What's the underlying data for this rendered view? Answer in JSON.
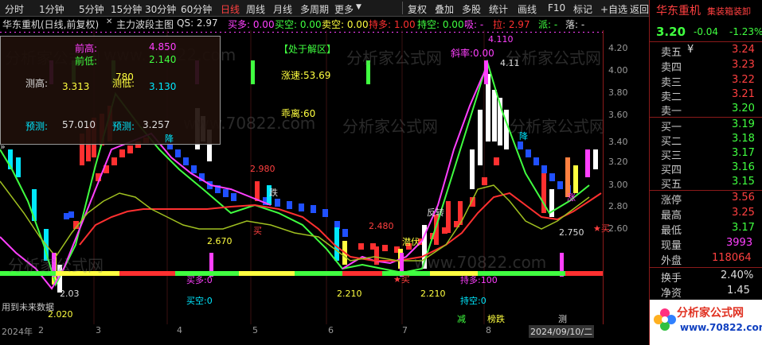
{
  "toolbar": {
    "periods": [
      "分时",
      "1分钟",
      "5分钟",
      "15分钟",
      "30分钟",
      "60分钟",
      "日线",
      "周线",
      "月线",
      "多周期",
      "更多"
    ],
    "active_period": "日线",
    "actions": [
      "复权",
      "叠加",
      "多股",
      "统计",
      "画线",
      "F10",
      "标记",
      "+自选",
      "返回"
    ]
  },
  "infobar": {
    "title": "华东重机(日线,前复权)",
    "indicator": "主力波段主图",
    "qs": "QS: 2.97",
    "buy_many": "买多: 0.00",
    "buy_empty": "买空: 0.00",
    "sell_empty": "卖空: 0.00",
    "hold_many": "持多: 1.00",
    "hold_empty": "持空: 0.00",
    "absorb": "吸: -",
    "pull": "拉: 2.97",
    "dispatch": "派: -",
    "drop": "落: -"
  },
  "infobox": {
    "prev_high_label": "前高:",
    "prev_high": "4.850",
    "prev_low_label": "前低:",
    "prev_low": "2.140",
    "measure_high_label": "测高:",
    "measure_high": "3.313",
    "measure_low_label": "测低:",
    "measure_low": "3.130",
    "forecast_label": "预测:",
    "forecast": "57.010",
    "forecast2_label": "预测:",
    "forecast2": "3.257"
  },
  "annotations": {
    "zone": "【处于解区】",
    "rise_speed": "涨速:53.69",
    "deviation": "乖离:60",
    "slope": "斜率:0.00",
    "peak": "4.110",
    "peak2": "4.11",
    "v2980": "2.980",
    "v2670": "2.670",
    "v2480": "2.480",
    "v2210a": "2.210",
    "v2210b": "2.210",
    "v2750": "2.750",
    "v203": "2.03",
    "v2020": "2.020",
    "v780": "780",
    "reverse": "反转",
    "lurk": "潜伏",
    "die": "跌",
    "buy": "买",
    "buy_star": "★买",
    "buy_star2": "★买",
    "buy_many_low": "买多:0",
    "buy_empty_low": "买空:0",
    "hold_many_low": "持多:100",
    "hold_empty_low": "持空:0",
    "future_data": "用到未来数据",
    "jiang": "降",
    "jiang2": "降",
    "zhang": "涨",
    "jian": "减",
    "bang": "榜跌",
    "ce": "测",
    "wm1": "分析家公式网",
    "wm2": "www.70822.com",
    "logo_main": "分析家公式网",
    "logo_url": "www.70822.com"
  },
  "yaxis": [
    "4.20",
    "4.00",
    "3.80",
    "3.60",
    "3.40",
    "3.20",
    "3.00",
    "2.80",
    "2.60"
  ],
  "xaxis": [
    "2024年",
    "2",
    "3",
    "4",
    "5",
    "6",
    "7",
    "8",
    "2024/09/10/二"
  ],
  "quote": {
    "name": "华东重机",
    "tag": "集装箱装卸",
    "price": "3.20",
    "change": "-0.04",
    "pct": "-1.23%",
    "asks": [
      {
        "label": "卖五",
        "extra": "¥",
        "price": "3.24"
      },
      {
        "label": "卖四",
        "extra": "",
        "price": "3.23"
      },
      {
        "label": "卖三",
        "extra": "",
        "price": "3.22"
      },
      {
        "label": "卖二",
        "extra": "",
        "price": "3.21"
      },
      {
        "label": "卖一",
        "extra": "",
        "price": "3.20"
      }
    ],
    "bids": [
      {
        "label": "买一",
        "price": "3.19"
      },
      {
        "label": "买二",
        "price": "3.18"
      },
      {
        "label": "买三",
        "price": "3.17"
      },
      {
        "label": "买四",
        "price": "3.16"
      },
      {
        "label": "买五",
        "price": "3.15"
      }
    ],
    "stats": [
      {
        "label": "涨停",
        "value": "3.56"
      },
      {
        "label": "最高",
        "value": "3.25"
      },
      {
        "label": "最低",
        "value": "3.17"
      },
      {
        "label": "现量",
        "value": "3993"
      },
      {
        "label": "外盘",
        "value": "118064"
      },
      {
        "label": "换手",
        "value": "2.40%"
      },
      {
        "label": "净资",
        "value": "1.45"
      }
    ]
  },
  "colors": {
    "up": "#ff3030",
    "down": "#00e8ff",
    "green": "#40ff40",
    "yellow": "#ffff40",
    "magenta": "#ff40ff",
    "bg": "#000000"
  }
}
